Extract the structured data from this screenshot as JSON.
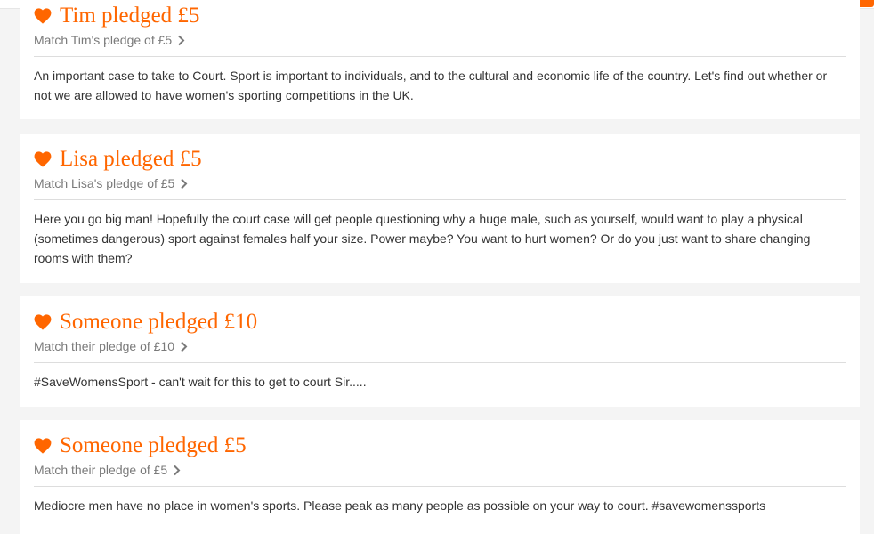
{
  "colors": {
    "accent": "#ff6600",
    "tab_indicator": "#3fcfb5",
    "text": "#333333",
    "muted": "#7a7a7a"
  },
  "pledges": [
    {
      "title": "Tim pledged £5",
      "match": "Match Tim's pledge of £5",
      "message": "An important case to take to Court. Sport is important to individuals, and to the cultural and economic life of the country. Let's find out whether or not we are allowed to have women's sporting competitions in the UK."
    },
    {
      "title": "Lisa pledged £5",
      "match": "Match Lisa's pledge of £5",
      "message": "Here you go big man! Hopefully the court case will get people questioning why a huge male, such as yourself, would want to play a physical (sometimes dangerous) sport against females half your size. Power maybe? You want to hurt women? Or do you just want to share changing rooms with them?"
    },
    {
      "title": "Someone pledged £10",
      "match": "Match their pledge of £10",
      "message": "#SaveWomensSport - can't wait for this to get to court Sir....."
    },
    {
      "title": "Someone pledged £5",
      "match": "Match their pledge of £5",
      "message": "Mediocre men have no place in women's sports. Please peak as many people as possible on your way to court. #savewomenssports"
    }
  ]
}
